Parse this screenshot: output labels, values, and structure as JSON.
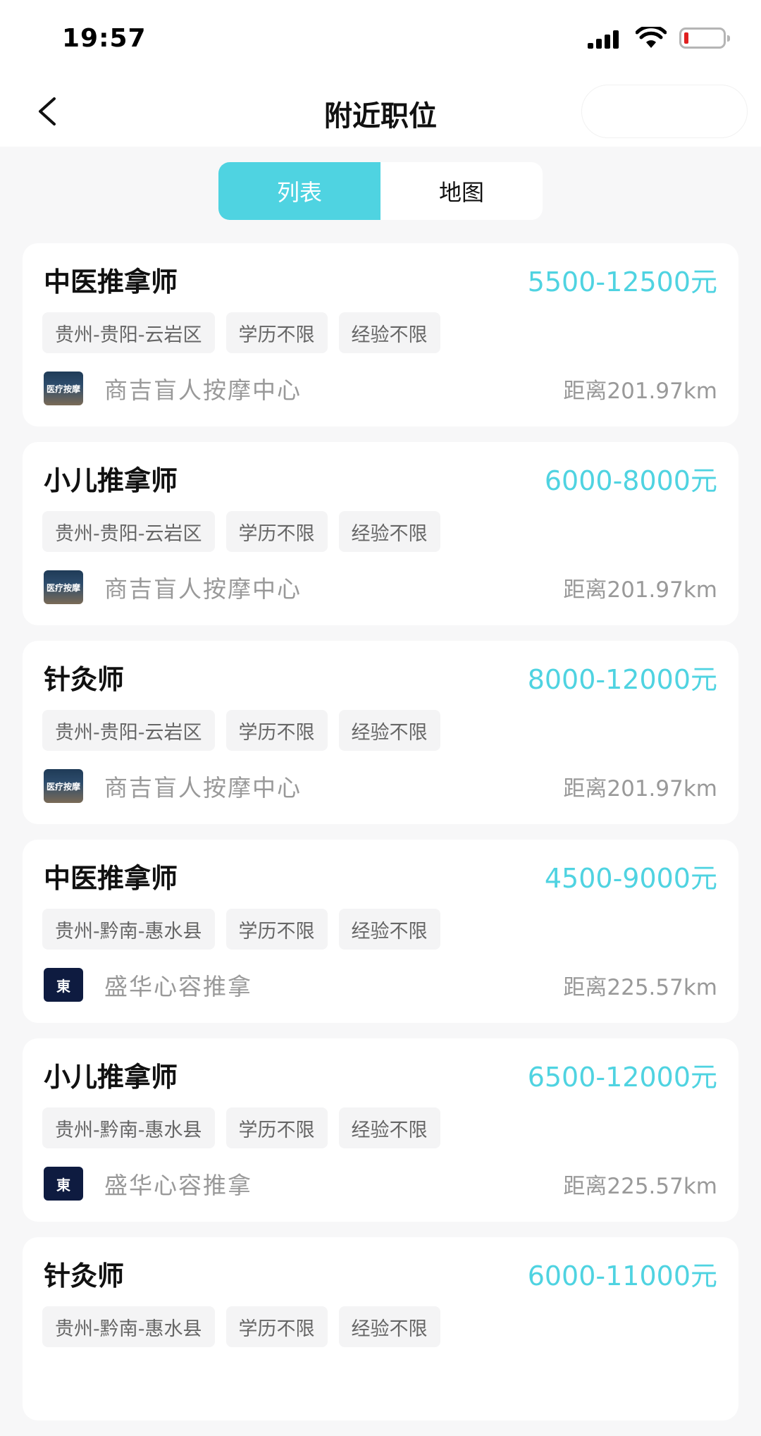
{
  "status_bar": {
    "time": "19:57"
  },
  "nav": {
    "title": "附近职位"
  },
  "segment": {
    "tabs": [
      {
        "label": "列表",
        "active": true
      },
      {
        "label": "地图",
        "active": false
      }
    ]
  },
  "colors": {
    "accent": "#4fd3e1",
    "battery_low": "#e02020"
  },
  "jobs": [
    {
      "title": "中医推拿师",
      "salary": "5500-12500元",
      "tags": [
        "贵州-贵阳-云岩区",
        "学历不限",
        "经验不限"
      ],
      "company": "商吉盲人按摩中心",
      "distance": "距离201.97km",
      "logo_text": "医疗按摩"
    },
    {
      "title": "小儿推拿师",
      "salary": "6000-8000元",
      "tags": [
        "贵州-贵阳-云岩区",
        "学历不限",
        "经验不限"
      ],
      "company": "商吉盲人按摩中心",
      "distance": "距离201.97km",
      "logo_text": "医疗按摩"
    },
    {
      "title": "针灸师",
      "salary": "8000-12000元",
      "tags": [
        "贵州-贵阳-云岩区",
        "学历不限",
        "经验不限"
      ],
      "company": "商吉盲人按摩中心",
      "distance": "距离201.97km",
      "logo_text": "医疗按摩"
    },
    {
      "title": "中医推拿师",
      "salary": "4500-9000元",
      "tags": [
        "贵州-黔南-惠水县",
        "学历不限",
        "经验不限"
      ],
      "company": "盛华心容推拿",
      "distance": "距离225.57km",
      "logo_text": "東"
    },
    {
      "title": "小儿推拿师",
      "salary": "6500-12000元",
      "tags": [
        "贵州-黔南-惠水县",
        "学历不限",
        "经验不限"
      ],
      "company": "盛华心容推拿",
      "distance": "距离225.57km",
      "logo_text": "東"
    },
    {
      "title": "针灸师",
      "salary": "6000-11000元",
      "tags": [
        "贵州-黔南-惠水县",
        "学历不限",
        "经验不限"
      ],
      "company": "",
      "distance": "",
      "logo_text": ""
    }
  ]
}
